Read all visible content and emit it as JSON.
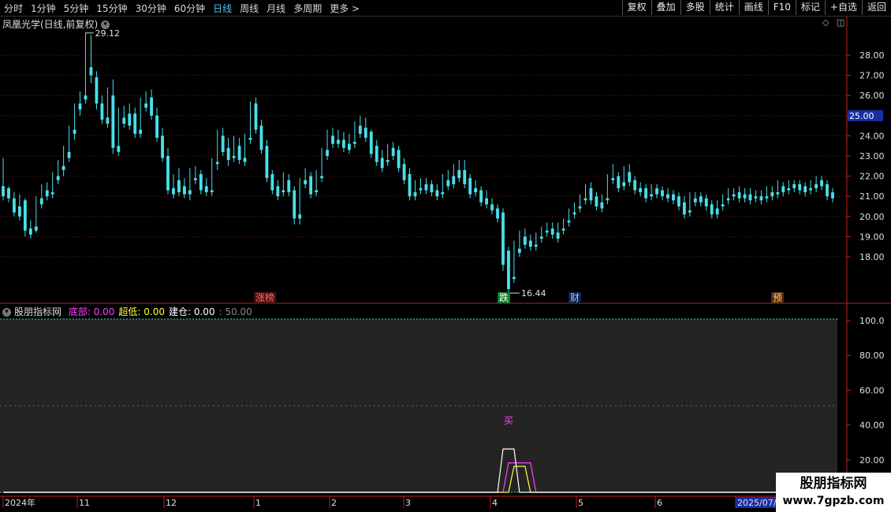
{
  "toolbar": {
    "periods": [
      {
        "label": "分时",
        "active": false
      },
      {
        "label": "1分钟",
        "active": false
      },
      {
        "label": "5分钟",
        "active": false
      },
      {
        "label": "15分钟",
        "active": false
      },
      {
        "label": "30分钟",
        "active": false
      },
      {
        "label": "60分钟",
        "active": false
      },
      {
        "label": "日线",
        "active": true
      },
      {
        "label": "周线",
        "active": false
      },
      {
        "label": "月线",
        "active": false
      },
      {
        "label": "多周期",
        "active": false
      },
      {
        "label": "更多 >",
        "active": false
      }
    ],
    "actions": [
      "复权",
      "叠加",
      "多股",
      "统计",
      "画线",
      "F10",
      "标记",
      "+自选",
      "返回"
    ]
  },
  "main_chart": {
    "title": "凤凰光学(日线,前复权)",
    "price_axis": [
      "28.00",
      "27.00",
      "26.00",
      "25.00",
      "24.00",
      "23.00",
      "22.00",
      "21.00",
      "20.00",
      "19.00",
      "18.00"
    ],
    "current_price_tag": "25.00",
    "high_label": "29.12",
    "low_label": "16.44",
    "events": [
      {
        "label": "涨榜",
        "color": "#ff6a6a",
        "bg": "#4a1010"
      },
      {
        "label": "跌",
        "color": "#ffffff",
        "bg": "#137a2a"
      },
      {
        "label": "财",
        "color": "#a0c8ff",
        "bg": "#10204a"
      },
      {
        "label": "预",
        "color": "#ffd080",
        "bg": "#5a2a08"
      }
    ]
  },
  "indicator": {
    "name": "股朋指标网",
    "items": [
      {
        "label": "底部:",
        "value": "0.00",
        "color": "#ff40ff"
      },
      {
        "label": "超低:",
        "value": "0.00",
        "color": "#ffff40"
      },
      {
        "label": "建仓:",
        "value": "0.00",
        "color": "#ffffff"
      },
      {
        "label": ":",
        "value": "50.00",
        "color": "#888888"
      }
    ],
    "axis": [
      "100.0",
      "80.00",
      "60.00",
      "40.00",
      "20.00"
    ],
    "buy_label": "买"
  },
  "time_axis": [
    "2024年",
    "11",
    "12",
    "1",
    "2",
    "3",
    "4",
    "5",
    "6",
    "2025/07/0"
  ],
  "watermark": {
    "line1": "股朋指标网",
    "line2": "www.7gpzb.com"
  },
  "chart_data": {
    "type": "candlestick",
    "title": "凤凰光学(日线,前复权)",
    "ylim": [
      16.0,
      29.5
    ],
    "x": [
      "2024年",
      "11",
      "12",
      "1",
      "2",
      "3",
      "4",
      "5",
      "6",
      "2025/07/0"
    ],
    "candles": [
      [
        21.5,
        22.9,
        21.0,
        20.8
      ],
      [
        21.4,
        21.5,
        20.9,
        20.7
      ],
      [
        20.9,
        21.2,
        20.2,
        20.0
      ],
      [
        20.5,
        21.1,
        20.0,
        19.8
      ],
      [
        20.8,
        20.9,
        19.3,
        19.0
      ],
      [
        19.4,
        19.8,
        19.1,
        18.9
      ],
      [
        19.5,
        21.0,
        19.3,
        19.2
      ],
      [
        20.9,
        21.6,
        20.6,
        20.4
      ],
      [
        21.3,
        21.7,
        21.0,
        20.8
      ],
      [
        21.2,
        22.2,
        21.1,
        20.9
      ],
      [
        22.0,
        22.8,
        21.8,
        21.6
      ],
      [
        22.5,
        23.5,
        22.3,
        22.0
      ],
      [
        23.2,
        24.5,
        22.9,
        22.7
      ],
      [
        24.3,
        25.6,
        24.1,
        23.8
      ],
      [
        25.6,
        26.2,
        25.3,
        25.0
      ],
      [
        26.0,
        29.1,
        25.8,
        25.6
      ],
      [
        27.4,
        29.0,
        27.0,
        26.6
      ],
      [
        26.9,
        27.2,
        25.6,
        25.3
      ],
      [
        25.6,
        26.0,
        24.8,
        24.6
      ],
      [
        24.9,
        26.4,
        24.6,
        24.4
      ],
      [
        26.0,
        26.8,
        23.4,
        23.1
      ],
      [
        23.5,
        25.4,
        23.2,
        23.0
      ],
      [
        24.9,
        25.5,
        24.6,
        24.4
      ],
      [
        25.1,
        25.6,
        24.5,
        24.3
      ],
      [
        25.1,
        25.4,
        24.1,
        23.9
      ],
      [
        24.3,
        25.9,
        24.1,
        23.9
      ],
      [
        25.6,
        26.2,
        25.4,
        25.2
      ],
      [
        25.9,
        26.3,
        25.0,
        24.8
      ],
      [
        25.0,
        25.4,
        23.9,
        23.7
      ],
      [
        24.0,
        24.4,
        22.9,
        22.7
      ],
      [
        23.0,
        23.4,
        21.3,
        21.1
      ],
      [
        21.4,
        22.1,
        21.1,
        20.9
      ],
      [
        21.8,
        22.4,
        21.2,
        21.0
      ],
      [
        21.5,
        21.9,
        21.1,
        20.9
      ],
      [
        21.3,
        22.4,
        21.1,
        20.8
      ],
      [
        21.9,
        22.5,
        21.8,
        21.6
      ],
      [
        22.1,
        22.3,
        21.3,
        21.1
      ],
      [
        21.5,
        21.9,
        21.2,
        21.0
      ],
      [
        21.3,
        22.9,
        21.2,
        21.0
      ],
      [
        22.7,
        24.3,
        22.6,
        22.3
      ],
      [
        24.0,
        24.4,
        23.2,
        23.0
      ],
      [
        23.4,
        23.9,
        22.8,
        22.5
      ],
      [
        23.0,
        24.0,
        22.9,
        22.7
      ],
      [
        23.5,
        23.9,
        22.8,
        22.6
      ],
      [
        22.9,
        24.1,
        22.7,
        22.5
      ],
      [
        23.9,
        25.7,
        23.8,
        23.6
      ],
      [
        25.6,
        25.9,
        24.3,
        24.1
      ],
      [
        24.5,
        24.8,
        23.3,
        23.1
      ],
      [
        23.5,
        23.8,
        21.9,
        21.7
      ],
      [
        22.1,
        22.3,
        21.3,
        21.1
      ],
      [
        21.5,
        21.8,
        21.0,
        20.8
      ],
      [
        21.3,
        22.2,
        21.2,
        21.0
      ],
      [
        21.8,
        22.1,
        21.2,
        21.0
      ],
      [
        21.3,
        21.5,
        19.9,
        19.6
      ],
      [
        20.1,
        21.9,
        19.9,
        19.6
      ],
      [
        21.8,
        22.4,
        21.6,
        21.4
      ],
      [
        22.0,
        22.2,
        21.1,
        20.9
      ],
      [
        21.3,
        22.3,
        21.2,
        21.0
      ],
      [
        22.0,
        23.4,
        21.9,
        21.7
      ],
      [
        23.3,
        24.3,
        23.0,
        22.8
      ],
      [
        24.0,
        24.4,
        23.6,
        23.4
      ],
      [
        23.8,
        24.3,
        23.6,
        23.4
      ],
      [
        23.8,
        24.2,
        23.4,
        23.2
      ],
      [
        23.6,
        24.1,
        23.3,
        23.1
      ],
      [
        23.7,
        24.7,
        23.6,
        23.4
      ],
      [
        24.5,
        25.0,
        24.1,
        23.9
      ],
      [
        24.4,
        24.9,
        23.9,
        23.7
      ],
      [
        24.2,
        24.3,
        23.1,
        22.9
      ],
      [
        23.5,
        23.8,
        22.7,
        22.5
      ],
      [
        22.9,
        23.3,
        22.4,
        22.2
      ],
      [
        22.8,
        23.6,
        22.7,
        22.5
      ],
      [
        23.4,
        23.7,
        23.0,
        22.8
      ],
      [
        23.3,
        23.5,
        22.4,
        22.2
      ],
      [
        22.6,
        22.9,
        21.8,
        21.6
      ],
      [
        22.1,
        22.4,
        21.0,
        20.8
      ],
      [
        21.2,
        21.8,
        21.0,
        20.8
      ],
      [
        21.4,
        21.9,
        21.3,
        21.1
      ],
      [
        21.6,
        21.9,
        21.3,
        21.1
      ],
      [
        21.6,
        21.8,
        21.2,
        21.0
      ],
      [
        21.3,
        21.6,
        21.0,
        20.8
      ],
      [
        21.2,
        22.1,
        21.1,
        20.9
      ],
      [
        21.8,
        22.3,
        21.5,
        21.3
      ],
      [
        22.0,
        22.6,
        21.6,
        21.4
      ],
      [
        22.3,
        22.8,
        21.9,
        21.7
      ],
      [
        22.3,
        22.8,
        21.6,
        21.4
      ],
      [
        21.9,
        22.1,
        21.1,
        20.9
      ],
      [
        21.4,
        21.8,
        21.2,
        21.0
      ],
      [
        21.3,
        21.5,
        20.7,
        20.5
      ],
      [
        20.9,
        21.3,
        20.6,
        20.4
      ],
      [
        20.6,
        20.9,
        20.3,
        20.1
      ],
      [
        20.4,
        20.6,
        19.9,
        19.7
      ],
      [
        20.2,
        20.4,
        17.6,
        17.3
      ],
      [
        18.3,
        18.5,
        16.4,
        16.2
      ],
      [
        17.0,
        18.8,
        16.9,
        16.7
      ],
      [
        18.4,
        19.3,
        18.2,
        18.0
      ],
      [
        19.0,
        19.4,
        18.6,
        18.4
      ],
      [
        18.8,
        19.1,
        18.5,
        18.3
      ],
      [
        18.6,
        19.2,
        18.5,
        18.3
      ],
      [
        19.0,
        19.5,
        18.9,
        18.7
      ],
      [
        19.3,
        19.7,
        19.2,
        19.0
      ],
      [
        19.4,
        19.7,
        19.1,
        18.9
      ],
      [
        19.2,
        19.7,
        18.9,
        18.7
      ],
      [
        19.4,
        19.9,
        19.3,
        19.1
      ],
      [
        19.8,
        20.4,
        19.7,
        19.5
      ],
      [
        20.2,
        20.7,
        20.1,
        19.9
      ],
      [
        20.5,
        21.1,
        20.4,
        20.2
      ],
      [
        20.9,
        21.6,
        20.8,
        20.6
      ],
      [
        21.4,
        21.7,
        20.8,
        20.6
      ],
      [
        21.0,
        21.2,
        20.5,
        20.3
      ],
      [
        20.7,
        21.1,
        20.4,
        20.2
      ],
      [
        20.9,
        22.1,
        20.8,
        20.6
      ],
      [
        21.9,
        22.6,
        21.8,
        21.6
      ],
      [
        22.0,
        22.2,
        21.4,
        21.2
      ],
      [
        21.7,
        22.5,
        21.5,
        21.3
      ],
      [
        22.2,
        22.6,
        21.7,
        21.5
      ],
      [
        21.8,
        22.0,
        21.3,
        21.1
      ],
      [
        21.4,
        21.7,
        21.2,
        21.0
      ],
      [
        21.4,
        21.6,
        20.9,
        20.7
      ],
      [
        21.1,
        21.6,
        21.0,
        20.8
      ],
      [
        21.4,
        21.6,
        21.1,
        20.9
      ],
      [
        21.3,
        21.5,
        21.0,
        20.8
      ],
      [
        21.1,
        21.4,
        20.9,
        20.7
      ],
      [
        21.1,
        21.3,
        20.8,
        20.6
      ],
      [
        21.0,
        21.2,
        20.5,
        20.3
      ],
      [
        20.7,
        21.0,
        20.1,
        19.9
      ],
      [
        20.3,
        21.2,
        20.2,
        20.0
      ],
      [
        20.9,
        21.2,
        20.7,
        20.5
      ],
      [
        21.0,
        21.2,
        20.7,
        20.5
      ],
      [
        20.9,
        21.1,
        20.5,
        20.3
      ],
      [
        20.6,
        20.8,
        20.1,
        19.9
      ],
      [
        20.4,
        20.8,
        20.1,
        19.9
      ],
      [
        20.6,
        21.1,
        20.5,
        20.3
      ],
      [
        20.9,
        21.4,
        20.8,
        20.6
      ],
      [
        21.1,
        21.4,
        21.0,
        20.8
      ],
      [
        21.2,
        21.5,
        20.9,
        20.7
      ],
      [
        21.1,
        21.4,
        20.9,
        20.7
      ],
      [
        21.1,
        21.4,
        20.8,
        20.6
      ],
      [
        21.0,
        21.3,
        20.9,
        20.7
      ],
      [
        21.0,
        21.3,
        20.8,
        20.6
      ],
      [
        21.0,
        21.5,
        20.9,
        20.7
      ],
      [
        21.2,
        21.5,
        21.0,
        20.8
      ],
      [
        21.2,
        21.8,
        21.1,
        20.9
      ],
      [
        21.5,
        21.7,
        21.2,
        21.0
      ],
      [
        21.4,
        21.8,
        21.3,
        21.1
      ],
      [
        21.6,
        21.8,
        21.4,
        21.2
      ],
      [
        21.6,
        21.8,
        21.3,
        21.1
      ],
      [
        21.5,
        21.7,
        21.2,
        21.0
      ],
      [
        21.4,
        21.8,
        21.3,
        21.1
      ],
      [
        21.6,
        22.0,
        21.4,
        21.2
      ],
      [
        21.8,
        22.0,
        21.5,
        21.3
      ],
      [
        21.6,
        21.8,
        21.0,
        20.8
      ],
      [
        21.2,
        21.4,
        20.9,
        20.7
      ]
    ],
    "indicator_series": [
      {
        "name": "底部",
        "color": "#ff40ff",
        "values": [
          0,
          0,
          0,
          0,
          0,
          0,
          0,
          0,
          0,
          0,
          0,
          0,
          0,
          0,
          0,
          0,
          0,
          0,
          0,
          0,
          0,
          0,
          0,
          0,
          0,
          0,
          0,
          0,
          0,
          0,
          0,
          0,
          0,
          0,
          0,
          0,
          0,
          0,
          0,
          0,
          0,
          0,
          0,
          0,
          0,
          0,
          0,
          0,
          0,
          0,
          0,
          0,
          0,
          0,
          0,
          0,
          0,
          0,
          0,
          0,
          0,
          0,
          0,
          0,
          0,
          0,
          0,
          0,
          0,
          0,
          0,
          0,
          0,
          0,
          0,
          0,
          0,
          0,
          0,
          0,
          0,
          0,
          0,
          0,
          0,
          0,
          0,
          0,
          0,
          0,
          0,
          0,
          17,
          17,
          17,
          17,
          17,
          0,
          0,
          0,
          0,
          0,
          0,
          0,
          0,
          0,
          0,
          0,
          0,
          0,
          0,
          0,
          0,
          0,
          0,
          0,
          0,
          0,
          0,
          0,
          0,
          0,
          0,
          0,
          0,
          0,
          0,
          0,
          0,
          0,
          0,
          0,
          0,
          0,
          0,
          0,
          0,
          0,
          0,
          0,
          0,
          0,
          0,
          0,
          0,
          0,
          0,
          0
        ]
      },
      {
        "name": "超低",
        "color": "#ffff40",
        "values": [
          0,
          0,
          0,
          0,
          0,
          0,
          0,
          0,
          0,
          0,
          0,
          0,
          0,
          0,
          0,
          0,
          0,
          0,
          0,
          0,
          0,
          0,
          0,
          0,
          0,
          0,
          0,
          0,
          0,
          0,
          0,
          0,
          0,
          0,
          0,
          0,
          0,
          0,
          0,
          0,
          0,
          0,
          0,
          0,
          0,
          0,
          0,
          0,
          0,
          0,
          0,
          0,
          0,
          0,
          0,
          0,
          0,
          0,
          0,
          0,
          0,
          0,
          0,
          0,
          0,
          0,
          0,
          0,
          0,
          0,
          0,
          0,
          0,
          0,
          0,
          0,
          0,
          0,
          0,
          0,
          0,
          0,
          0,
          0,
          0,
          0,
          0,
          0,
          0,
          0,
          0,
          0,
          0,
          15,
          15,
          15,
          0,
          0,
          0,
          0,
          0,
          0,
          0,
          0,
          0,
          0,
          0,
          0,
          0,
          0,
          0,
          0,
          0,
          0,
          0,
          0,
          0,
          0,
          0,
          0,
          0,
          0,
          0,
          0,
          0,
          0,
          0,
          0,
          0,
          0,
          0,
          0,
          0,
          0,
          0,
          0,
          0,
          0,
          0,
          0,
          0,
          0,
          0,
          0,
          0,
          0,
          0,
          0,
          0,
          0
        ]
      },
      {
        "name": "建仓",
        "color": "#ffffff",
        "values": [
          0,
          0,
          0,
          0,
          0,
          0,
          0,
          0,
          0,
          0,
          0,
          0,
          0,
          0,
          0,
          0,
          0,
          0,
          0,
          0,
          0,
          0,
          0,
          0,
          0,
          0,
          0,
          0,
          0,
          0,
          0,
          0,
          0,
          0,
          0,
          0,
          0,
          0,
          0,
          0,
          0,
          0,
          0,
          0,
          0,
          0,
          0,
          0,
          0,
          0,
          0,
          0,
          0,
          0,
          0,
          0,
          0,
          0,
          0,
          0,
          0,
          0,
          0,
          0,
          0,
          0,
          0,
          0,
          0,
          0,
          0,
          0,
          0,
          0,
          0,
          0,
          0,
          0,
          0,
          0,
          0,
          0,
          0,
          0,
          0,
          0,
          0,
          0,
          0,
          0,
          0,
          25,
          25,
          25,
          0,
          0,
          0,
          0,
          0,
          0,
          0,
          0,
          0,
          0,
          0,
          0,
          0,
          0,
          0,
          0,
          0,
          0,
          0,
          0,
          0,
          0,
          0,
          0,
          0,
          0,
          0,
          0,
          0,
          0,
          0,
          0,
          0,
          0,
          0,
          0,
          0,
          0,
          0,
          0,
          0,
          0,
          0,
          0,
          0,
          0,
          0,
          0,
          0,
          0,
          0,
          0,
          0,
          0
        ]
      }
    ],
    "indicator_ylim": [
      0,
      100
    ]
  },
  "colors": {
    "up": "#ff4a4a",
    "down": "#48e0e8",
    "grid": "#7a1a1a",
    "axis_text": "#e0e0e0",
    "panel_bg": "#242424"
  }
}
